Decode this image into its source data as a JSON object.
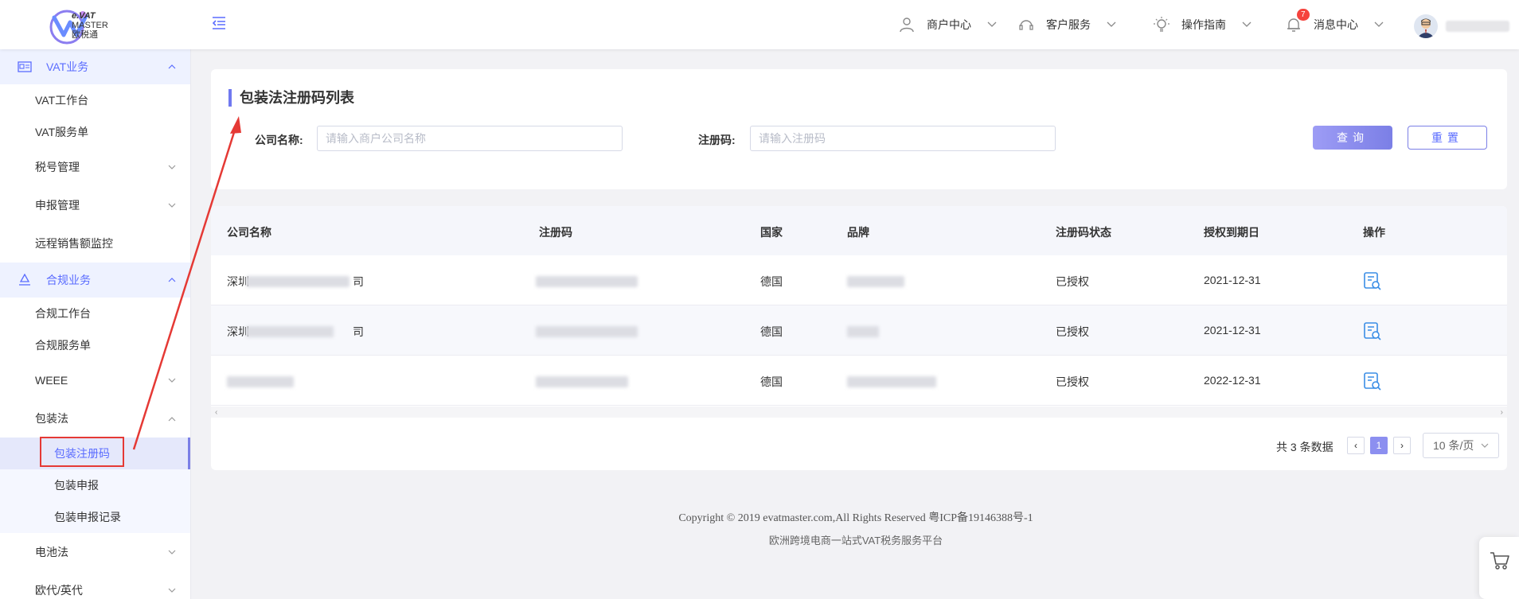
{
  "header": {
    "logo_line1": "e.VAT",
    "logo_line2": "MASTER",
    "logo_line3": "欧税通",
    "nav": [
      {
        "label": "商户中心",
        "icon": "user-icon"
      },
      {
        "label": "客户服务",
        "icon": "headset-icon"
      },
      {
        "label": "操作指南",
        "icon": "lightbulb-icon"
      },
      {
        "label": "消息中心",
        "icon": "bell-icon"
      }
    ],
    "message_count": "7"
  },
  "sidebar": {
    "group_vat": "VAT业务",
    "vat_items": [
      "VAT工作台",
      "VAT服务单",
      "税号管理",
      "申报管理",
      "远程销售额监控"
    ],
    "group_compliance": "合规业务",
    "compliance_items": [
      "合规工作台",
      "合规服务单",
      "WEEE",
      "包装法"
    ],
    "packaging_sub": [
      "包装注册码",
      "包装申报",
      "包装申报记录"
    ],
    "after_items": [
      "电池法",
      "欧代/英代"
    ]
  },
  "search": {
    "title": "包装法注册码列表",
    "company_label": "公司名称:",
    "company_placeholder": "请输入商户公司名称",
    "code_label": "注册码:",
    "code_placeholder": "请输入注册码",
    "query_button": "查询",
    "reset_button": "重置"
  },
  "table": {
    "columns": [
      "公司名称",
      "注册码",
      "国家",
      "品牌",
      "注册码状态",
      "授权到期日",
      "操作"
    ],
    "rows": [
      {
        "company_prefix": "深圳",
        "company_suffix": "司",
        "country": "德国",
        "status": "已授权",
        "expiry": "2021-12-31"
      },
      {
        "company_prefix": "深圳",
        "company_suffix": "司",
        "country": "德国",
        "status": "已授权",
        "expiry": "2021-12-31"
      },
      {
        "company_prefix": "",
        "company_suffix": "",
        "country": "德国",
        "status": "已授权",
        "expiry": "2022-12-31"
      }
    ]
  },
  "pagination": {
    "total": "共 3 条数据",
    "current_page": "1",
    "page_size": "10 条/页"
  },
  "footer": {
    "copyright": "Copyright © 2019 evatmaster.com,All Rights Reserved 粤ICP备19146388号-1",
    "slogan": "欧洲跨境电商一站式VAT税务服务平台"
  },
  "colors": {
    "accent": "#7b7fe6",
    "highlight_red": "#e53935"
  }
}
